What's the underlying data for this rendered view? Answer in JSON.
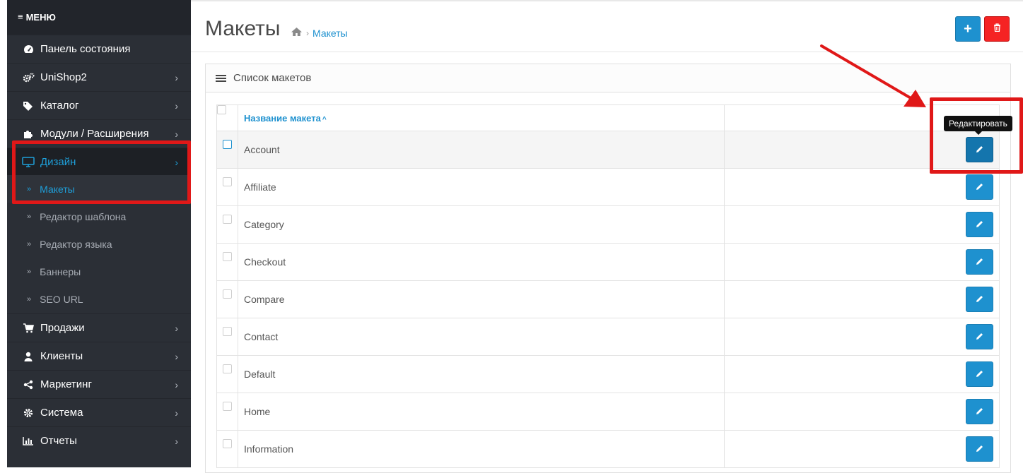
{
  "sidebar": {
    "header": "МЕНЮ",
    "items": [
      {
        "label": "Панель состояния",
        "icon": "dashboard-icon"
      },
      {
        "label": "UniShop2",
        "icon": "cogs-icon"
      },
      {
        "label": "Каталог",
        "icon": "tags-icon"
      },
      {
        "label": "Модули / Расширения",
        "icon": "puzzle-icon"
      },
      {
        "label": "Дизайн",
        "icon": "monitor-icon"
      },
      {
        "label": "Продажи",
        "icon": "cart-icon"
      },
      {
        "label": "Клиенты",
        "icon": "user-icon"
      },
      {
        "label": "Маркетинг",
        "icon": "share-icon"
      },
      {
        "label": "Система",
        "icon": "gear-icon"
      },
      {
        "label": "Отчеты",
        "icon": "bar-chart-icon"
      }
    ],
    "design_sub": [
      "Макеты",
      "Редактор шаблона",
      "Редактор языка",
      "Баннеры",
      "SEO URL"
    ]
  },
  "header": {
    "title": "Макеты",
    "breadcrumb": "Макеты"
  },
  "panel": {
    "title": "Список макетов",
    "col_name": "Название макета",
    "tooltip": "Редактировать",
    "rows": [
      "Account",
      "Affiliate",
      "Category",
      "Checkout",
      "Compare",
      "Contact",
      "Default",
      "Home",
      "Information"
    ]
  },
  "colors": {
    "accent": "#1e91cf",
    "danger": "#f52323",
    "sidebar_bg": "#2b2f36",
    "annotation": "#e01818"
  }
}
